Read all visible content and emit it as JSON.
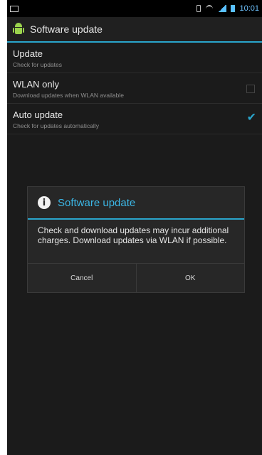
{
  "status_bar": {
    "time": "10:01",
    "icons": [
      "screenshot-icon",
      "vibrate-icon",
      "wifi-icon",
      "signal-icon",
      "battery-icon"
    ]
  },
  "action_bar": {
    "title": "Software update",
    "icon": "android-icon"
  },
  "preferences": [
    {
      "title": "Update",
      "summary": "Check for updates"
    },
    {
      "title": "WLAN only",
      "summary": "Download updates when WLAN available",
      "checked": false
    },
    {
      "title": "Auto update",
      "summary": "Check for updates automatically",
      "checked": true
    }
  ],
  "dialog": {
    "icon": "info-icon",
    "title": "Software update",
    "message": "Check and download updates may incur additional charges. Download updates via WLAN if possible.",
    "cancel_label": "Cancel",
    "ok_label": "OK"
  },
  "colors": {
    "accent": "#2aa5cc",
    "background": "#1b1b1b",
    "dialog_background": "#272727"
  }
}
